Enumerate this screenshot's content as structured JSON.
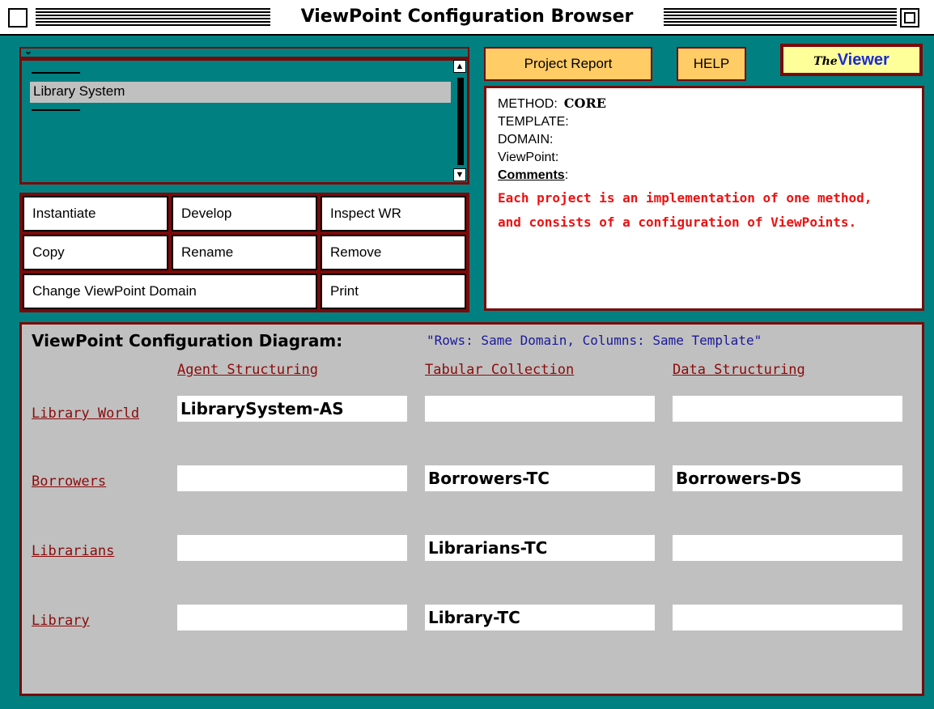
{
  "window": {
    "title": "ViewPoint Configuration Browser"
  },
  "project_list": {
    "selector_icon": "chevron-down-icon",
    "items": [
      {
        "label": "Library System",
        "selected": true
      }
    ]
  },
  "actions": {
    "instantiate": "Instantiate",
    "develop": "Develop",
    "inspect_wr": "Inspect WR",
    "copy": "Copy",
    "rename": "Rename",
    "remove": "Remove",
    "change_domain": "Change ViewPoint Domain",
    "print": "Print"
  },
  "top_buttons": {
    "project_report": "Project Report",
    "help": "HELP"
  },
  "viewer_logo": {
    "prefix": "The",
    "word": "Viewer"
  },
  "info": {
    "method_label": "METHOD:",
    "method_value": "CORE",
    "template_label": "TEMPLATE:",
    "domain_label": "DOMAIN:",
    "viewpoint_label": "ViewPoint:",
    "comments_label": "Comments",
    "comments_text": "Each project is an implementation of one method, and consists of a configuration of ViewPoints."
  },
  "diagram": {
    "title": "ViewPoint Configuration Diagram:",
    "subtitle": "\"Rows: Same Domain, Columns: Same Template\"",
    "columns": [
      "Agent Structuring",
      "Tabular Collection",
      "Data Structuring"
    ],
    "rows": [
      {
        "label": "Library World",
        "cells": [
          "LibrarySystem-AS",
          "",
          ""
        ]
      },
      {
        "label": "Borrowers",
        "cells": [
          "",
          "Borrowers-TC",
          "Borrowers-DS"
        ]
      },
      {
        "label": "Librarians",
        "cells": [
          "",
          "Librarians-TC",
          ""
        ]
      },
      {
        "label": "Library",
        "cells": [
          "",
          "Library-TC",
          ""
        ]
      }
    ]
  },
  "colors": {
    "background": "#008080",
    "frame": "#7a0a0a",
    "button_accent": "#ffcc66",
    "comment_text": "#ee1111",
    "link_text": "#8b0a0a"
  }
}
